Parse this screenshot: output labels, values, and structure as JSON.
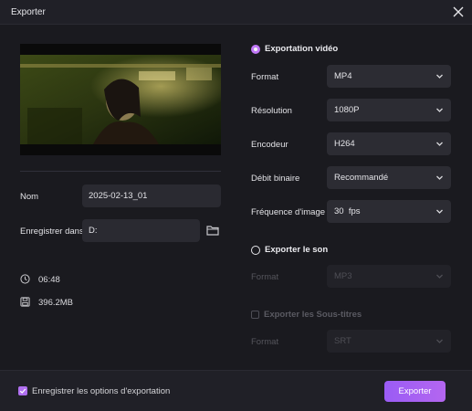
{
  "window": {
    "title": "Exporter"
  },
  "left": {
    "name_label": "Nom",
    "name_value": "2025-02-13_01",
    "save_label": "Enregistrer dans",
    "save_value": "D:",
    "duration": "06:48",
    "size": "396.2MB"
  },
  "video": {
    "heading": "Exportation vidéo",
    "format_label": "Format",
    "format_value": "MP4",
    "resolution_label": "Résolution",
    "resolution_value": "1080P",
    "encoder_label": "Encodeur",
    "encoder_value": "H264",
    "bitrate_label": "Débit binaire",
    "bitrate_value": "Recommandé",
    "framerate_label": "Fréquence d'image",
    "framerate_value": "30  fps"
  },
  "audio": {
    "heading": "Exporter le son",
    "format_label": "Format",
    "format_value": "MP3"
  },
  "subtitles": {
    "heading": "Exporter les Sous-titres",
    "format_label": "Format",
    "format_value": "SRT"
  },
  "footer": {
    "remember_label": "Enregistrer les options d'exportation",
    "export_label": "Exporter"
  },
  "colors": {
    "accent": "#b070f0",
    "background": "#1a1a1f"
  }
}
